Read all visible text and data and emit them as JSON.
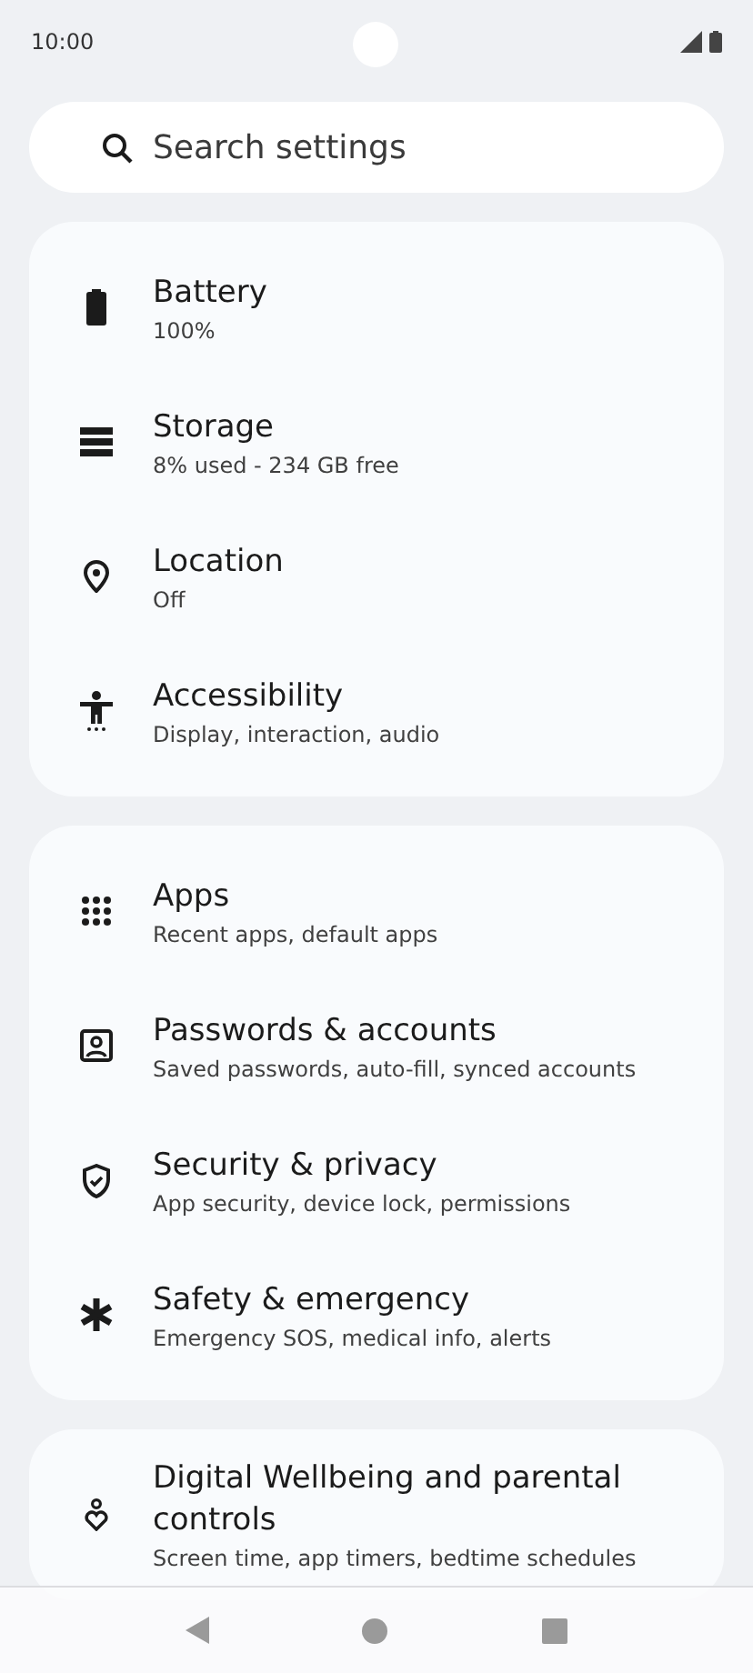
{
  "status_bar": {
    "time": "10:00"
  },
  "search": {
    "placeholder": "Search settings"
  },
  "groups": [
    {
      "items": [
        {
          "kind": "battery",
          "title": "Battery",
          "subtitle": "100%"
        },
        {
          "kind": "storage",
          "title": "Storage",
          "subtitle": "8% used - 234 GB free"
        },
        {
          "kind": "location",
          "title": "Location",
          "subtitle": "Off"
        },
        {
          "kind": "accessibility",
          "title": "Accessibility",
          "subtitle": "Display, interaction, audio"
        }
      ]
    },
    {
      "items": [
        {
          "kind": "apps",
          "title": "Apps",
          "subtitle": "Recent apps, default apps"
        },
        {
          "kind": "account",
          "title": "Passwords & accounts",
          "subtitle": "Saved passwords, auto-fill, synced accounts"
        },
        {
          "kind": "shield",
          "title": "Security & privacy",
          "subtitle": "App security, device lock, permissions"
        },
        {
          "kind": "asterisk",
          "title": "Safety & emergency",
          "subtitle": "Emergency SOS, medical info, alerts"
        }
      ]
    },
    {
      "items": [
        {
          "kind": "wellbeing",
          "title": "Digital Wellbeing and parental controls",
          "subtitle": "Screen time, app timers, bedtime schedules"
        }
      ]
    }
  ]
}
